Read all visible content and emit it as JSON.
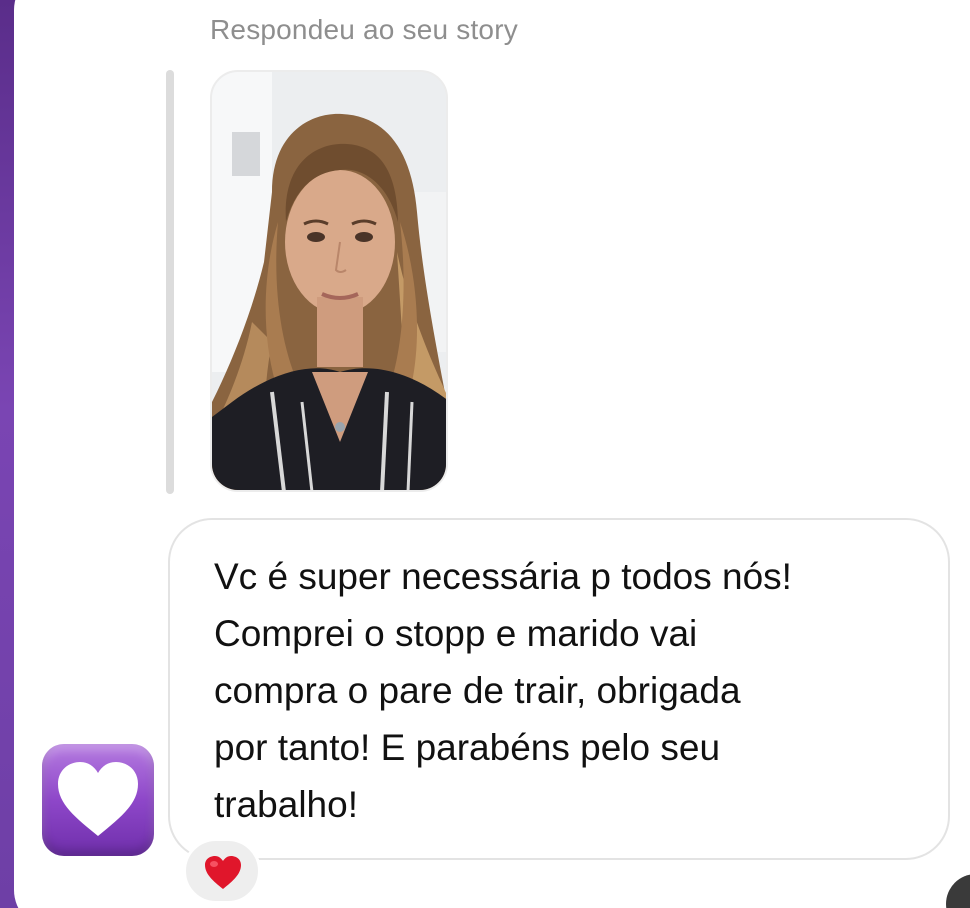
{
  "reply_caption": "Respondeu ao seu story",
  "story": {
    "thumbnail_icon": "story-photo"
  },
  "message": {
    "text": "Vc é super necessária p todos nós!\nComprei o stopp e marido  vai\ncompra o pare de trair, obrigada\npor tanto! E parabéns pelo seu\ntrabalho!"
  },
  "sender_avatar_icon": "purple-heart-emoji",
  "reaction": {
    "icon": "red-heart-icon",
    "color": "#e0162b"
  },
  "colors": {
    "background": "#6e3fa6",
    "avatar": "#8e47c9",
    "bubble_border": "#e3e3e3",
    "caption": "#8e8e8e"
  }
}
